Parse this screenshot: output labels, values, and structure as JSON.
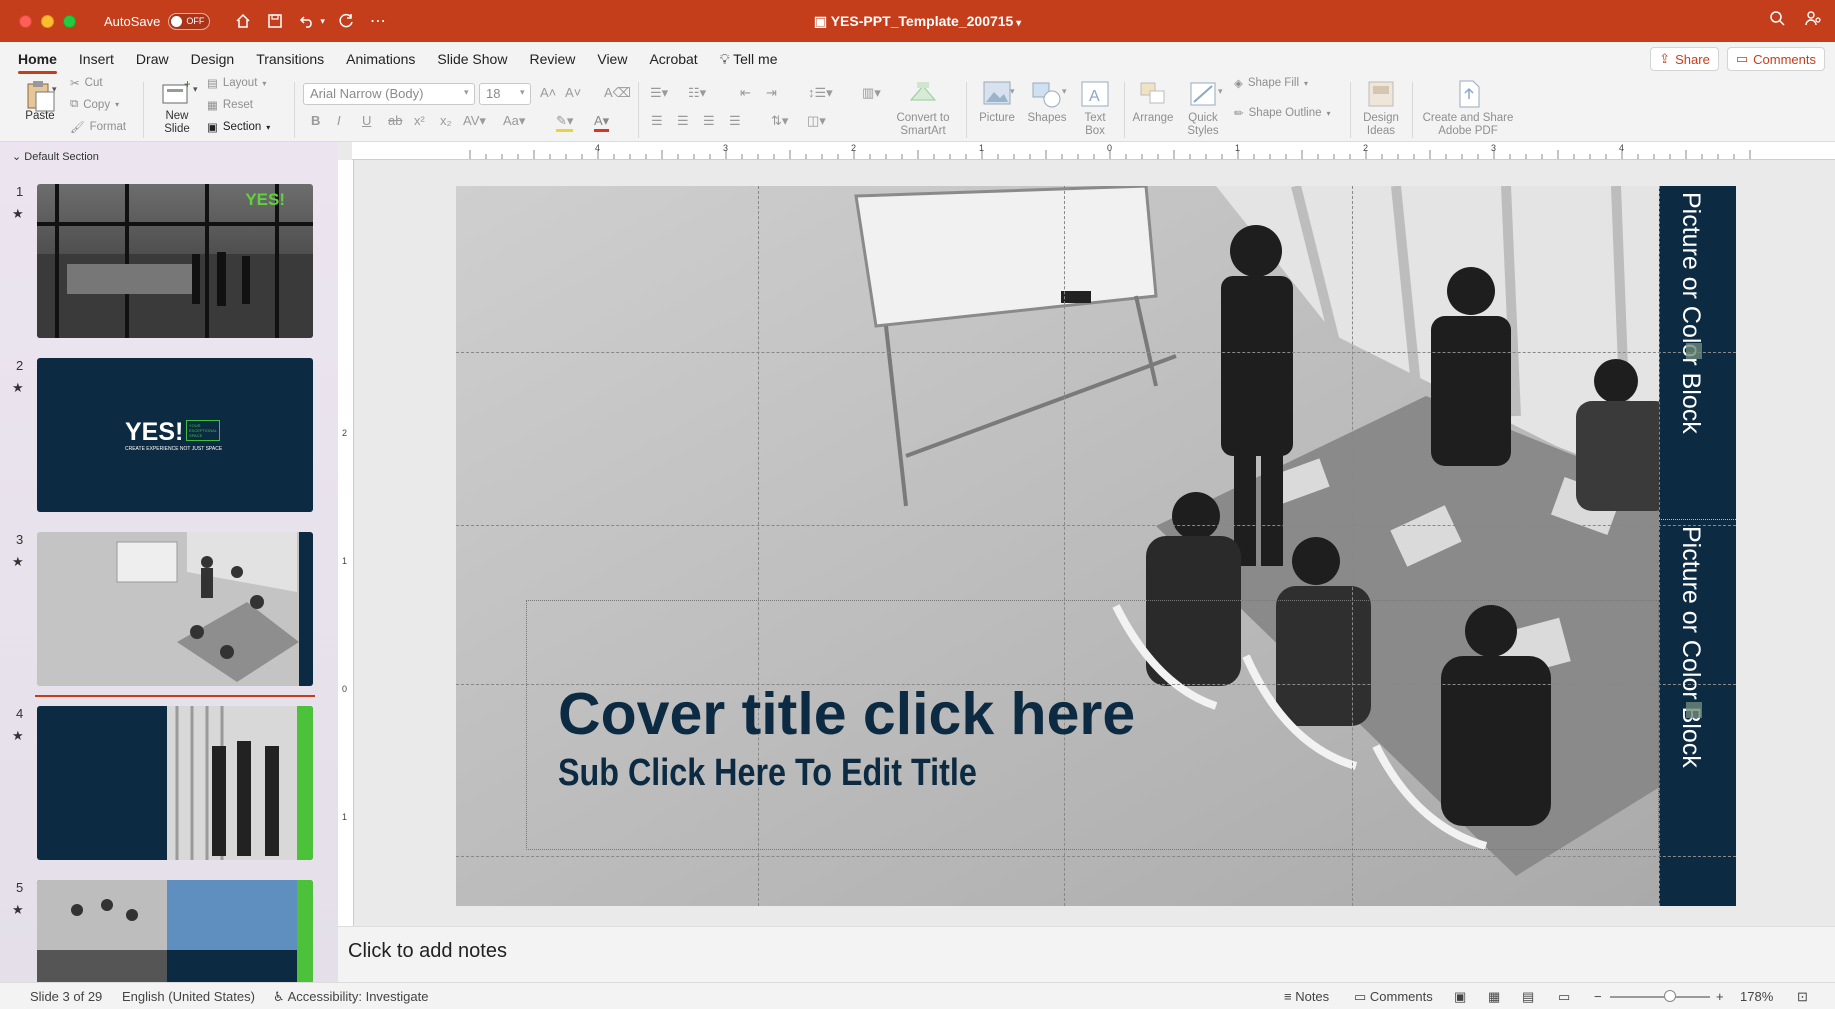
{
  "window": {
    "title": "YES-PPT_Template_200715",
    "autosave_label": "AutoSave",
    "autosave_state": "OFF"
  },
  "menu": {
    "tabs": [
      "Home",
      "Insert",
      "Draw",
      "Design",
      "Transitions",
      "Animations",
      "Slide Show",
      "Review",
      "View",
      "Acrobat"
    ],
    "tell_me": "Tell me",
    "share": "Share",
    "comments": "Comments"
  },
  "ribbon": {
    "paste": "Paste",
    "cut": "Cut",
    "copy": "Copy",
    "format": "Format",
    "new_slide": "New",
    "new_slide2": "Slide",
    "layout": "Layout",
    "reset": "Reset",
    "section": "Section",
    "font_name": "Arial Narrow (Body)",
    "font_size": "18",
    "convert_smartart": "Convert to",
    "convert_smartart2": "SmartArt",
    "picture": "Picture",
    "shapes": "Shapes",
    "textbox": "Text",
    "textbox2": "Box",
    "arrange": "Arrange",
    "quick_styles": "Quick",
    "quick_styles2": "Styles",
    "shape_fill": "Shape Fill",
    "shape_outline": "Shape Outline",
    "design_ideas": "Design",
    "design_ideas2": "Ideas",
    "create_share": "Create and Share",
    "create_share2": "Adobe PDF"
  },
  "slides_pane": {
    "section": "Default Section",
    "slides": [
      {
        "num": "1",
        "yes": "YES!"
      },
      {
        "num": "2",
        "yes": "YES!",
        "tag": "YOUR EXCEPTIONAL SPACE",
        "sub": "CREATE EXPERIENCE NOT JUST SPACE"
      },
      {
        "num": "3"
      },
      {
        "num": "4"
      },
      {
        "num": "5"
      }
    ]
  },
  "slide": {
    "title": "Cover title click here",
    "subtitle": "Sub Click Here To Edit Title",
    "side_text_1": "Picture or Color Block",
    "side_text_2": "Picture or Color Block"
  },
  "ruler": {
    "h": [
      "4",
      "3",
      "2",
      "1",
      "0",
      "1",
      "2",
      "3",
      "4"
    ],
    "v": [
      "2",
      "1",
      "0",
      "1",
      "2"
    ]
  },
  "notes": {
    "placeholder": "Click to add notes"
  },
  "status": {
    "slide_info": "Slide 3 of 29",
    "language": "English (United States)",
    "accessibility": "Accessibility: Investigate",
    "notes": "Notes",
    "comments": "Comments",
    "zoom": "178%"
  },
  "colors": {
    "accent": "#c43e1c",
    "navy": "#0c2b42",
    "title_text": "#0c2b42",
    "green": "#3fbf3f"
  }
}
